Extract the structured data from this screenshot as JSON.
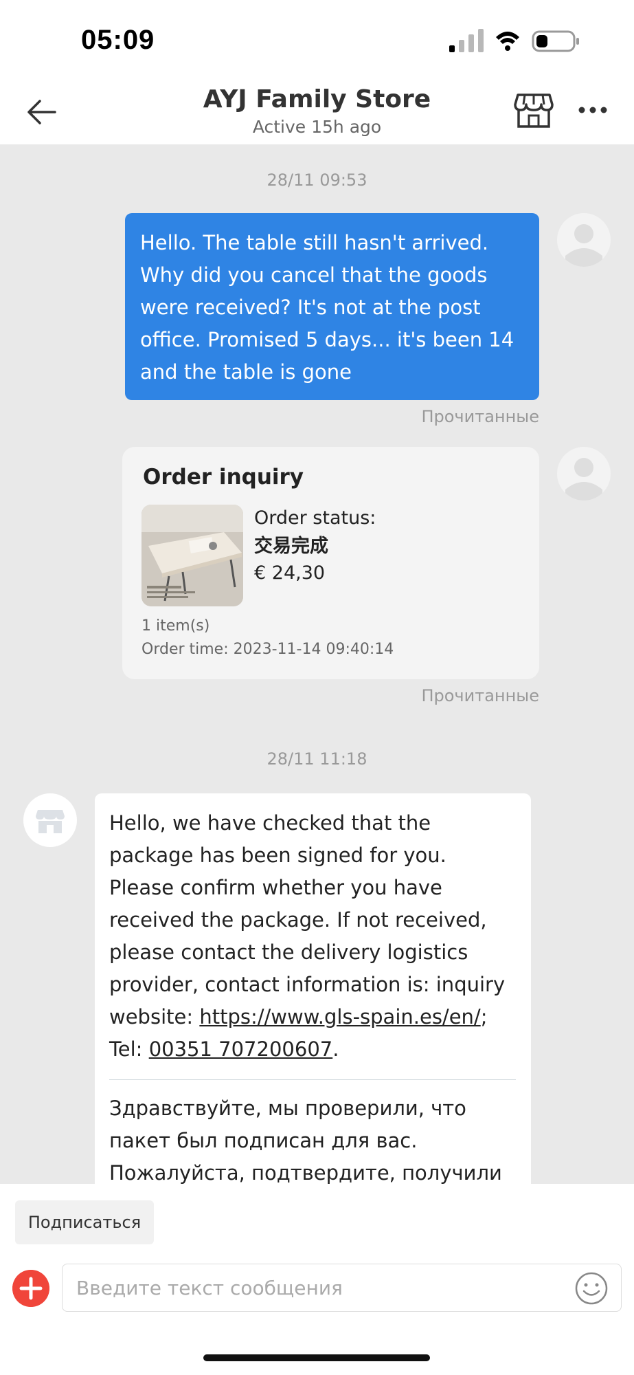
{
  "status_bar": {
    "time": "05:09",
    "icons": [
      "cellular-signal-icon",
      "wifi-icon",
      "battery-icon"
    ]
  },
  "header": {
    "title": "AYJ Family Store",
    "subtitle": "Active 15h ago",
    "back_icon": "back-arrow-icon",
    "shop_icon": "shop-icon",
    "more_icon": "more-icon"
  },
  "chat": {
    "timestamp_1": "28/11 09:53",
    "user_message": "Hello. The table still hasn't arrived. Why did you cancel that the goods were received? It's not at the post office. Promised 5 days... it's been 14 and the table is gone",
    "read_label_1": "Прочитанные",
    "order": {
      "title": "Order inquiry",
      "status_label": "Order status:",
      "status_value": "交易完成",
      "price": "€ 24,30",
      "items": "1 item(s)",
      "order_time": "Order time: 2023-11-14 09:40:14"
    },
    "read_label_2": "Прочитанные",
    "timestamp_2": "28/11 11:18",
    "store_reply": {
      "en_text": "Hello, we have checked that the package has been signed for you. Please confirm whether you have received the package. If not received, please contact the delivery logistics provider, contact information is: inquiry website: ",
      "link_url": "https://www.gls-spain.es/en/",
      "tel_prefix": "; Tel: ",
      "tel_number": "00351 707200607",
      "tel_suffix": ".",
      "ru_text": "Здравствуйте, мы проверили, что пакет был подписан для вас. Пожалуйста, подтвердите, получили ли вы пакет. Если не получено, свяжитесь с"
    }
  },
  "bottom": {
    "subscribe_label": "Подписаться",
    "input_placeholder": "Введите текст сообщения",
    "plus_icon": "plus-icon",
    "emoji_icon": "emoji-icon"
  },
  "colors": {
    "accent_blue": "#2f84e4",
    "accent_red": "#f0453a",
    "chat_background": "#e9e9e9"
  }
}
